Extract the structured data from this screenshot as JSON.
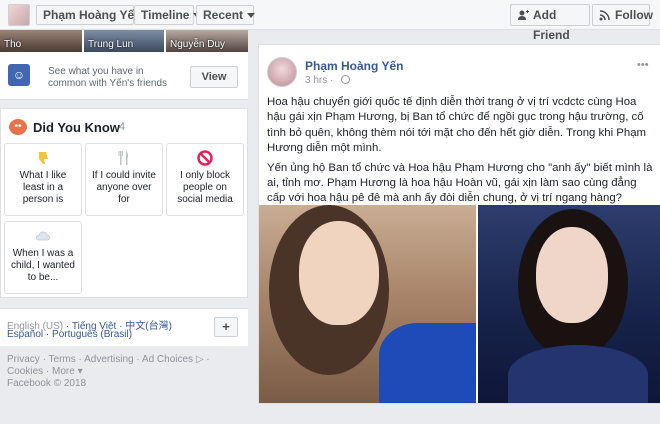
{
  "topbar": {
    "name_button": "Phạm Hoàng Yến",
    "timeline_button": "Timeline",
    "recent_button": "Recent",
    "add_friend": "Add Friend",
    "follow": "Follow"
  },
  "friends_thumbs": [
    {
      "label": "Tho"
    },
    {
      "label": "Trung Lun"
    },
    {
      "label": "Nguyễn Duy"
    }
  ],
  "common": {
    "text": "See what you have in common with Yến's friends",
    "button": "View"
  },
  "did_you_know": {
    "title": "Did You Know",
    "count": "4",
    "cards": [
      {
        "text": "What I like least in a person is",
        "icon": "thumbs-down-icon"
      },
      {
        "text": "If I could invite anyone over for",
        "icon": "fork-knife-icon"
      },
      {
        "text": "I only block people on social media",
        "icon": "block-icon"
      },
      {
        "text": "When I was a child, I wanted to be...",
        "icon": "cloud-icon"
      }
    ]
  },
  "languages": {
    "current": "English (US)",
    "row1_links": [
      "Tiếng Việt",
      "中文(台灣)"
    ],
    "row2_links": [
      "Español",
      "Português (Brasil)"
    ],
    "more_button": "+"
  },
  "footer": {
    "links": [
      "Privacy",
      "Terms",
      "Advertising",
      "Ad Choices",
      "Cookies",
      "More"
    ],
    "copyright": "Facebook © 2018"
  },
  "post": {
    "author": "Phạm Hoàng Yến",
    "time": "3 hrs",
    "paragraph1": "Hoa hậu chuyển giới quốc tế định diễn thời trang ở vị trí vcdctc cùng Hoa hậu gái xịn Phạm Hương, bị Ban tổ chức để ngồi gục trong hậu trường, cố tình bỏ quên, không thèm nói tới mặt cho đến hết giờ diễn. Trong khi Phạm Hương diễn một mình.",
    "paragraph2": "Yến ủng hộ Ban tổ chức và Hoa hậu Phạm Hương cho \"anh ấy\" biết mình là ai, tỉnh mơ. Phạm Hương là hoa hậu Hoàn vũ, gái xịn làm sao cùng đẳng cấp với hoa hậu pê đê mà anh ấy đòi diễn chung, ở vị trí ngang hàng?"
  },
  "colors": {
    "link": "#365899",
    "background": "#e9ebee",
    "brand": "#4267b2"
  }
}
